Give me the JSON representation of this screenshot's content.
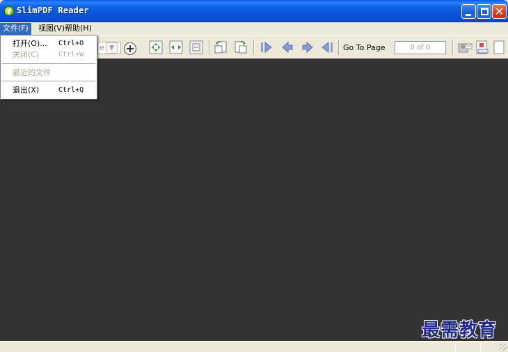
{
  "window": {
    "title": "SlimPDF Reader"
  },
  "menu": {
    "file": "文件(F)",
    "view": "视图(V)",
    "help": "帮助(H)"
  },
  "file_menu": {
    "open_label": "打开(O)...",
    "open_shortcut": "Ctrl+O",
    "close_label": "关闭(C)",
    "close_shortcut": "Ctrl+W",
    "recent_label": "最近的文件",
    "exit_label": "退出(X)",
    "exit_shortcut": "Ctrl+Q"
  },
  "toolbar": {
    "zoom_value": "e",
    "goto_label": "Go To Page",
    "page_indicator": "0 of 0"
  },
  "watermark": "最需教育",
  "icons": [
    "zoom-in-icon",
    "fit-page-icon",
    "fit-width-icon",
    "actual-size-icon",
    "rotate-left-icon",
    "rotate-right-icon",
    "first-page-icon",
    "previous-page-icon",
    "next-page-icon",
    "last-page-icon",
    "email-icon",
    "export-pdf-icon"
  ],
  "colors": {
    "titlebar": "#0a5ee8",
    "document_background": "#333333",
    "menu_highlight": "#316ac5"
  }
}
